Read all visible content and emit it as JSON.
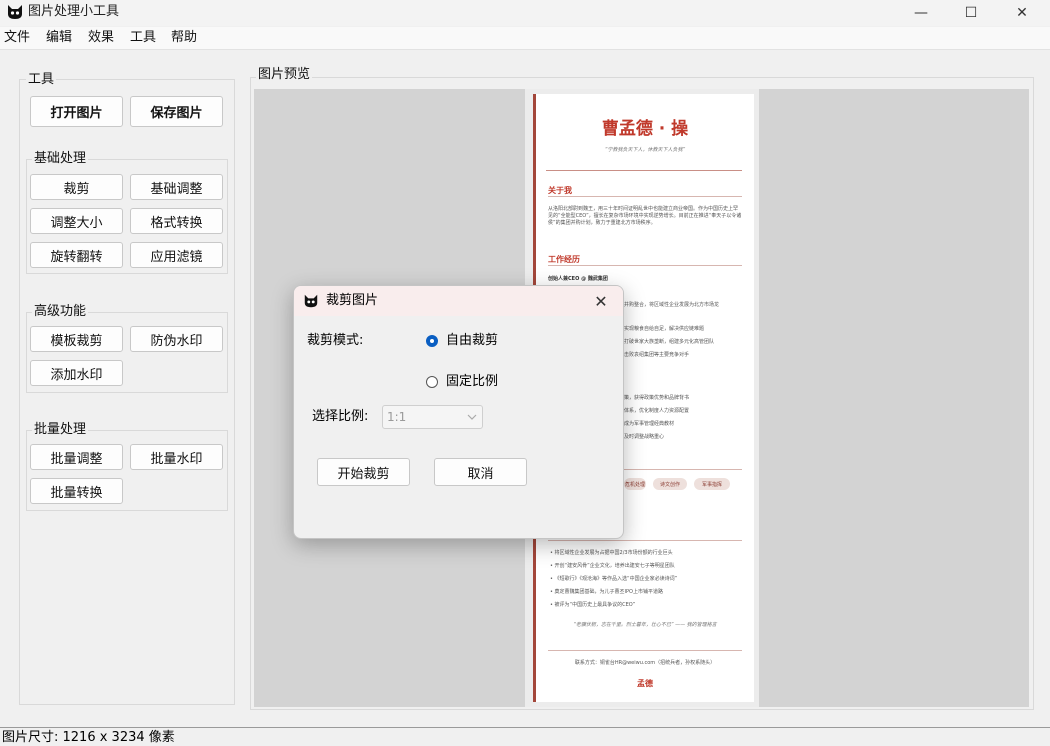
{
  "window": {
    "title": "图片处理小工具",
    "minimize_glyph": "—",
    "maximize_glyph": "☐",
    "close_glyph": "✕"
  },
  "menu": [
    "文件",
    "编辑",
    "效果",
    "工具",
    "帮助"
  ],
  "tools": {
    "title": "工具",
    "open_label": "打开图片",
    "save_label": "保存图片",
    "basic": {
      "title": "基础处理",
      "crop": "裁剪",
      "basic_adjust": "基础调整",
      "resize": "调整大小",
      "format_convert": "格式转换",
      "rotate_flip": "旋转翻转",
      "apply_filter": "应用滤镜"
    },
    "advanced": {
      "title": "高级功能",
      "template_crop": "模板裁剪",
      "anti_counterfeit_watermark": "防伪水印",
      "add_watermark": "添加水印"
    },
    "batch": {
      "title": "批量处理",
      "batch_adjust": "批量调整",
      "batch_watermark": "批量水印",
      "batch_convert": "批量转换"
    }
  },
  "preview": {
    "title": "图片预览",
    "doc": {
      "name": "曹孟德 · 操",
      "motto": "“宁教我负天下人，休教天下人负我”",
      "about_heading": "关于我",
      "about_text": "从洛阳北部尉到魏王，用三十年时间证明乱世中也能建立商业帝国。作为中国历史上罕见的“全能型CEO”，擅长在复杂市场环境中实现逆势增长。目前正在推进“奉天子以令诸侯”的集团并购计划，致力于重建北方市场秩序。",
      "work_heading": "工作经历",
      "work_role": "创始人兼CEO @ 魏武集团",
      "work_items": [
        "并购整合，将区域性企业发展为北方市场龙",
        "实现粮食自给自足，解决供应链难题",
        "打破世家大族垄断，组建多元化高管团队",
        "击败袁绍集团等主要竞争对手",
        "策，获得政策优势和品牌背书",
        "体系，优化制度人力资源配置",
        "成为军事管理经典教材",
        "及时调整战略重心"
      ],
      "tags": [
        "危机处理",
        "诗文创作",
        "军事指挥"
      ],
      "achievements": [
        "将区域性企业发展为占据中国2/3市场份额的行业巨头",
        "开创“建安风骨”企业文化，培养出建安七子等明星团队",
        "《短歌行》《观沧海》等作品入选“中国企业家必读诗词”",
        "奠定曹魏集团基础，为儿子曹丕IPO上市铺平道路",
        "被评为“中国历史上最具争议的CEO”"
      ],
      "quote": "“老骥伏枥，志在千里。烈士暮年，壮心不已” —— 我的管理格言",
      "contact": "联系方式：铜雀台HR@weiwu.com（招统兵者，孙权系随头）",
      "signature": "孟德"
    }
  },
  "status": {
    "text": "图片尺寸: 1216 x 3234 像素"
  },
  "dialog": {
    "title": "裁剪图片",
    "mode_label": "裁剪模式:",
    "free_crop": "自由裁剪",
    "fixed_ratio": "固定比例",
    "selected_mode": "free",
    "ratio_label": "选择比例:",
    "ratio_value": "1:1",
    "start_label": "开始裁剪",
    "cancel_label": "取消"
  },
  "colors": {
    "accent": "#0a5ec2",
    "resume_red": "#c0392b"
  }
}
